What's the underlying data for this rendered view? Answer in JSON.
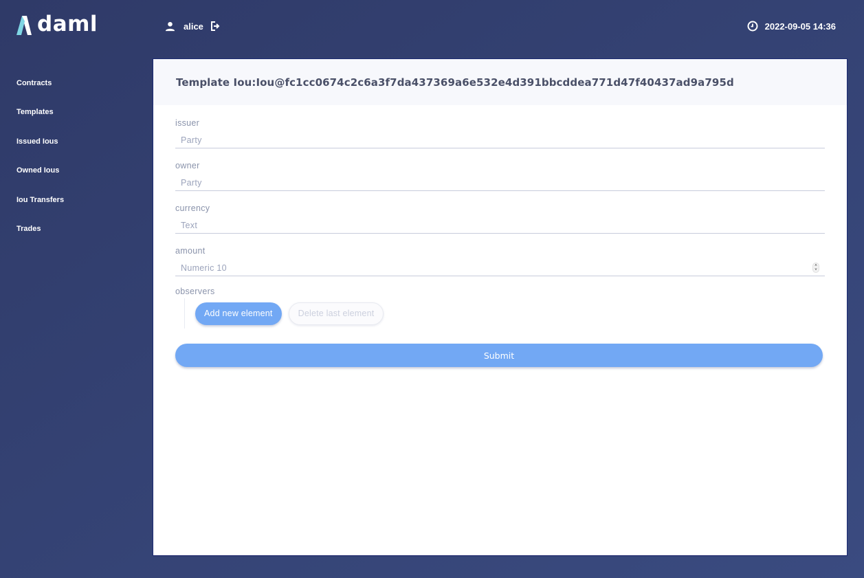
{
  "app": {
    "logo_text": "daml",
    "user": "alice",
    "datetime": "2022-09-05 14:36",
    "accent_color": "#72a8f4",
    "logo_accent_color": "#7fd6e4"
  },
  "sidebar": {
    "items": [
      {
        "label": "Contracts"
      },
      {
        "label": "Templates"
      },
      {
        "label": "Issued Ious"
      },
      {
        "label": "Owned Ious"
      },
      {
        "label": "Iou Transfers"
      },
      {
        "label": "Trades"
      }
    ]
  },
  "panel": {
    "title": "Template Iou:Iou@fc1cc0674c2c6a3f7da437369a6e532e4d391bbcddea771d47f40437ad9a795d"
  },
  "form": {
    "fields": [
      {
        "label": "issuer",
        "value": "",
        "placeholder": "Party"
      },
      {
        "label": "owner",
        "value": "",
        "placeholder": "Party"
      },
      {
        "label": "currency",
        "value": "",
        "placeholder": "Text"
      },
      {
        "label": "amount",
        "value": "",
        "placeholder": "Numeric 10"
      }
    ],
    "observers": {
      "label": "observers",
      "add_label": "Add new element",
      "delete_label": "Delete last element"
    },
    "submit_label": "Submit"
  },
  "icons": {
    "user": "person-icon",
    "logout": "logout-icon",
    "clock": "clock-icon",
    "spinner": "spinner-arrows-icon"
  }
}
